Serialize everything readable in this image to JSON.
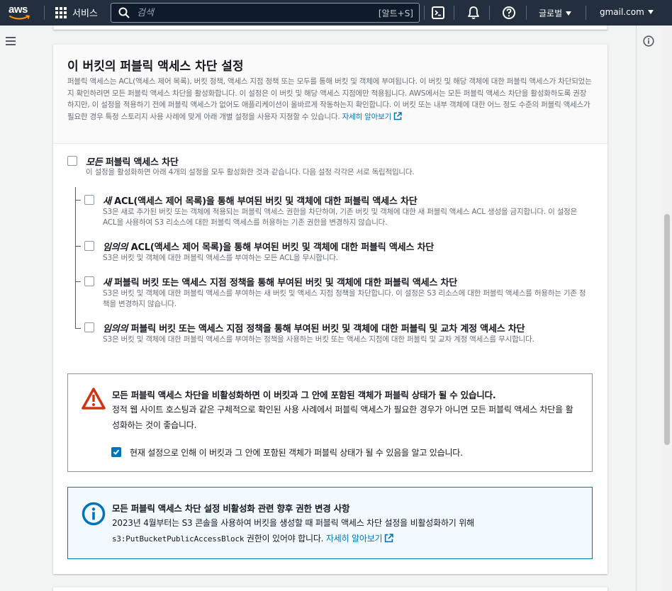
{
  "topnav": {
    "logo": "aws",
    "services_label": "서비스",
    "search_placeholder": "검색",
    "search_shortcut": "[알트+S]",
    "region_label": "글로벌",
    "account_label": "gmail.com"
  },
  "panel": {
    "title": "이 버킷의 퍼블릭 액세스 차단 설정",
    "description": "퍼블릭 액세스는 ACL(액세스 제어 목록), 버킷 정책, 액세스 지점 정책 또는 모두를 통해 버킷 및 객체에 부여됩니다. 이 버킷 및 해당 객체에 대한 퍼블릭 액세스가 차단되었는지 확인하려면 모든 퍼블릭 액세스 차단을 활성화합니다. 이 설정은 이 버킷 및 해당 액세스 지점에만 적용됩니다. AWS에서는 모든 퍼블릭 액세스 차단을 활성화하도록 권장하지만, 이 설정을 적용하기 전에 퍼블릭 액세스가 없어도 애플리케이션이 올바르게 작동하는지 확인합니다. 이 버킷 또는 내부 객체에 대한 어느 정도 수준의 퍼블릭 액세스가 필요한 경우 특정 스토리지 사용 사례에 맞게 아래 개별 설정을 사용자 지정할 수 있습니다.",
    "learn_more": "자세히 알아보기"
  },
  "block_all": {
    "title_em": "모든",
    "title_rest": " 퍼블릭 액세스 차단",
    "description": "이 설정을 활성화하면 아래 4개의 설정을 모두 활성화한 것과 같습니다. 다음 설정 각각은 서로 독립적입니다.",
    "checked": false
  },
  "options": [
    {
      "title_em": "새",
      "title_rest": " ACL(액세스 제어 목록)을 통해 부여된 버킷 및 객체에 대한 퍼블릭 액세스 차단",
      "description": "S3은 새로 추가된 버킷 또는 객체에 적용되는 퍼블릭 액세스 권한을 차단하며, 기존 버킷 및 객체에 대한 새 퍼블릭 액세스 ACL 생성을 금지합니다. 이 설정은 ACL을 사용하여 S3 리소스에 대한 퍼블릭 액세스를 허용하는 기존 권한을 변경하지 않습니다.",
      "checked": false
    },
    {
      "title_em": "임의의",
      "title_rest": " ACL(액세스 제어 목록)을 통해 부여된 버킷 및 객체에 대한 퍼블릭 액세스 차단",
      "description": "S3은 버킷 및 객체에 대한 퍼블릭 액세스를 부여하는 모든 ACL을 무시합니다.",
      "checked": false
    },
    {
      "title_em": "새",
      "title_rest": " 퍼블릭 버킷 또는 액세스 지점 정책을 통해 부여된 버킷 및 객체에 대한 퍼블릭 액세스 차단",
      "description": "S3은 버킷 및 객체에 대한 퍼블릭 액세스를 부여하는 새 버킷 및 액세스 지점 정책을 차단합니다. 이 설정은 S3 리소스에 대한 퍼블릭 액세스를 허용하는 기존 정책을 변경하지 않습니다.",
      "checked": false
    },
    {
      "title_em": "임의의",
      "title_rest": " 퍼블릭 버킷 또는 액세스 지점 정책을 통해 부여된 버킷 및 객체에 대한 퍼블릭 및 교차 계정 액세스 차단",
      "description": "S3은 버킷 및 객체에 대한 퍼블릭 액세스를 부여하는 정책을 사용하는 버킷 또는 액세스 지점에 대한 퍼블릭 및 교차 계정 액세스를 무시합니다.",
      "checked": false
    }
  ],
  "warning": {
    "title": "모든 퍼블릭 액세스 차단을 비활성화하면 이 버킷과 그 안에 포함된 객체가 퍼블릭 상태가 될 수 있습니다.",
    "body": "정적 웹 사이트 호스팅과 같은 구체적으로 확인된 사용 사례에서 퍼블릭 액세스가 필요한 경우가 아니면 모든 퍼블릭 액세스 차단을 활성화하는 것이 좋습니다.",
    "ack_label": "현재 설정으로 인해 이 버킷과 그 안에 포함된 객체가 퍼블릭 상태가 될 수 있음을 알고 있습니다.",
    "ack_checked": true
  },
  "info": {
    "title": "모든 퍼블릭 액세스 차단 설정 비활성화 관련 향후 권한 변경 사항",
    "body_prefix": "2023년 4월부터는 S3 콘솔을 사용하여 버킷을 생성할 때 퍼블릭 액세스 차단 설정을 비활성화하기 위해",
    "body_code": "s3:PutBucketPublicAccessBlock",
    "body_suffix": " 권한이 있어야 합니다. ",
    "learn_more": "자세히 알아보기"
  },
  "colors": {
    "nav_bg": "#232f3e",
    "link": "#0073bb",
    "warning": "#d13212",
    "info": "#0073bb"
  }
}
